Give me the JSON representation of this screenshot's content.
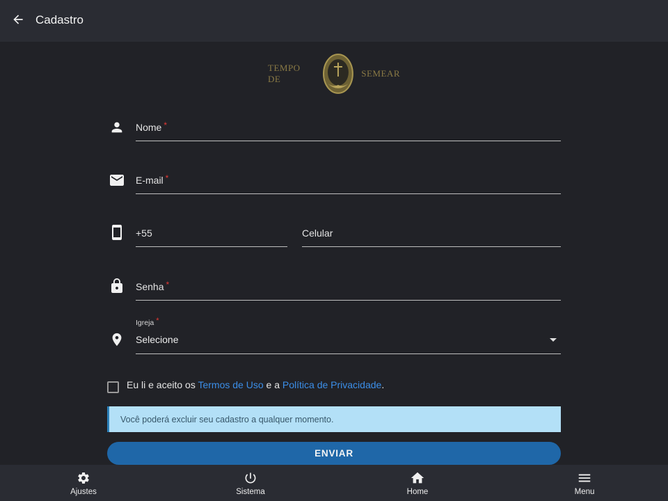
{
  "header": {
    "title": "Cadastro"
  },
  "logo": {
    "left_text": "TEMPO DE",
    "right_text": "SEMEAR"
  },
  "form": {
    "nome": {
      "label": "Nome",
      "required_mark": "*"
    },
    "email": {
      "label": "E-mail",
      "required_mark": "*"
    },
    "phone": {
      "country_code": "+55",
      "label": "Celular"
    },
    "senha": {
      "label": "Senha",
      "required_mark": "*"
    },
    "igreja": {
      "label": "Igreja",
      "required_mark": "*",
      "selected": "Selecione"
    }
  },
  "terms": {
    "prefix": "Eu li e aceito os ",
    "link1": "Termos de Uso",
    "middle": " e a ",
    "link2": "Política de Privacidade",
    "suffix": "."
  },
  "info": {
    "text": "Você poderá excluir seu cadastro a qualquer momento."
  },
  "submit": {
    "label": "ENVIAR"
  },
  "bottom_nav": {
    "items": [
      {
        "label": "Ajustes",
        "icon": "gear-icon"
      },
      {
        "label": "Sistema",
        "icon": "power-icon"
      },
      {
        "label": "Home",
        "icon": "home-icon"
      },
      {
        "label": "Menu",
        "icon": "menu-icon"
      }
    ]
  },
  "colors": {
    "background": "#212227",
    "bar": "#2a2c33",
    "accent": "#1f67a8",
    "link": "#3b8ee8",
    "info_bg": "#b3e0f7",
    "required": "#e53935",
    "logo_gold": "#8a7a45"
  }
}
